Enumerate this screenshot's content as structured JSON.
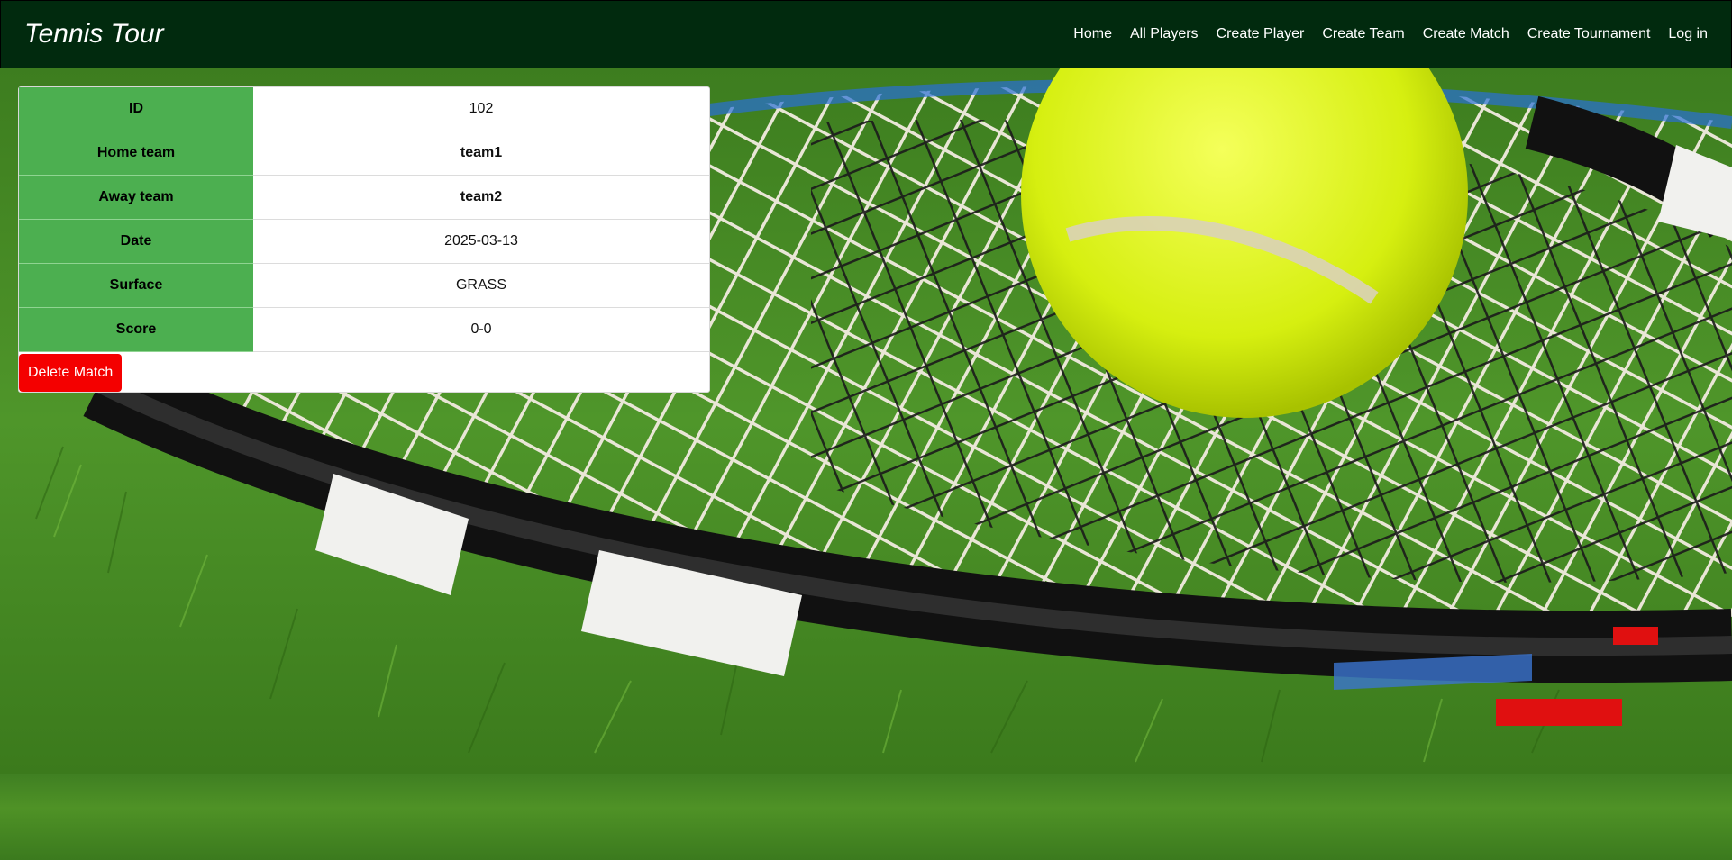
{
  "app": {
    "brand": "Tennis Tour"
  },
  "nav": {
    "items": [
      {
        "label": "Home"
      },
      {
        "label": "All Players"
      },
      {
        "label": "Create Player"
      },
      {
        "label": "Create Team"
      },
      {
        "label": "Create Match"
      },
      {
        "label": "Create Tournament"
      },
      {
        "label": "Log in"
      }
    ]
  },
  "match": {
    "rows": [
      {
        "key": "ID",
        "value": "102"
      },
      {
        "key": "Home team",
        "value": "team1"
      },
      {
        "key": "Away team",
        "value": "team2"
      },
      {
        "key": "Date",
        "value": "2025-03-13"
      },
      {
        "key": "Surface",
        "value": "GRASS"
      },
      {
        "key": "Score",
        "value": "0-0"
      }
    ],
    "delete_label": "Delete Match"
  },
  "colors": {
    "navbar": "#012a0e",
    "key_cell": "#4caf50",
    "delete_button": "#f40000"
  }
}
